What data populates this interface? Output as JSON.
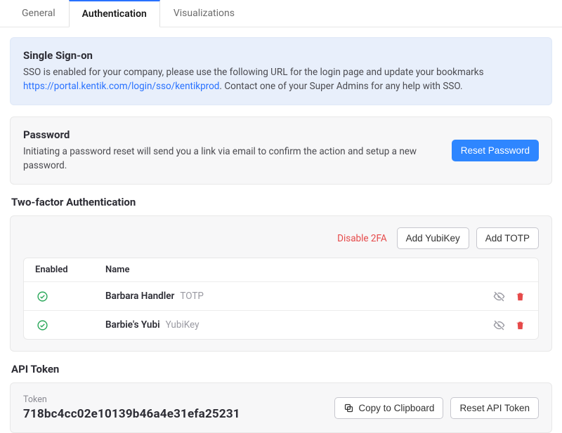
{
  "tabs": {
    "general": "General",
    "authentication": "Authentication",
    "visualizations": "Visualizations"
  },
  "sso": {
    "title": "Single Sign-on",
    "desc_prefix": "SSO is enabled for your company, please use the following URL for the login page and update your bookmarks ",
    "url": "https://portal.kentik.com/login/sso/kentikprod",
    "desc_suffix": ". Contact one of your Super Admins for any help with SSO."
  },
  "password": {
    "title": "Password",
    "desc": "Initiating a password reset will send you a link via email to confirm the action and setup a new password.",
    "reset_button": "Reset Password"
  },
  "tfa": {
    "heading": "Two-factor Authentication",
    "disable_label": "Disable 2FA",
    "add_yubikey": "Add YubiKey",
    "add_totp": "Add TOTP",
    "col_enabled": "Enabled",
    "col_name": "Name",
    "items": [
      {
        "name": "Barbara Handler",
        "type": "TOTP"
      },
      {
        "name": "Barbie's Yubi",
        "type": "YubiKey"
      }
    ]
  },
  "api": {
    "heading": "API Token",
    "token_label": "Token",
    "token_value": "718bc4cc02e10139b46a4e31efa25231",
    "copy_button": "Copy to Clipboard",
    "reset_button": "Reset API Token"
  }
}
